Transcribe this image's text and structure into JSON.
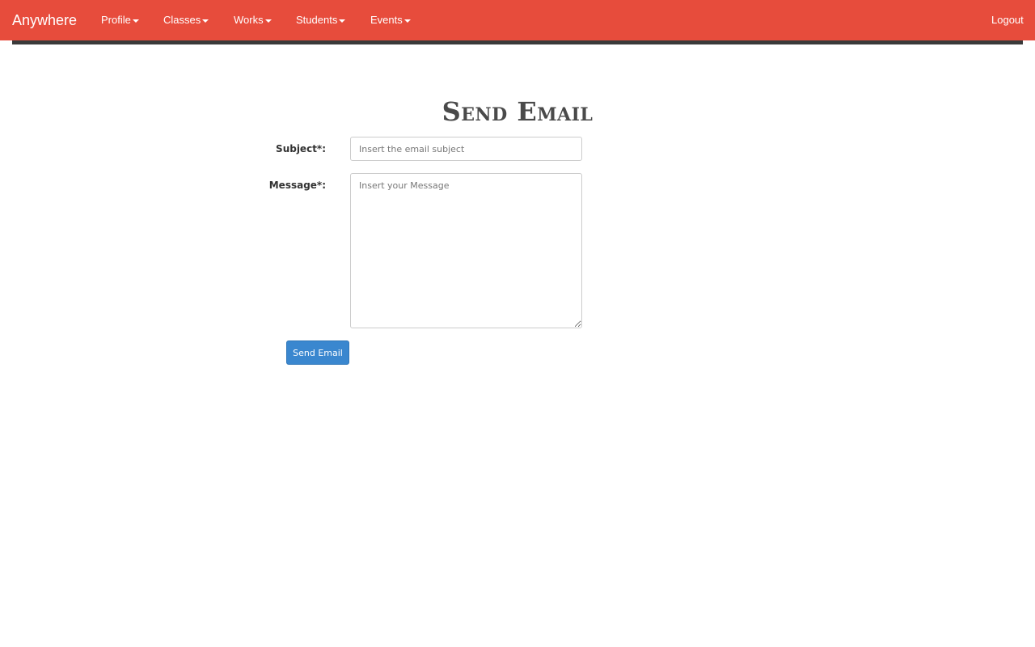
{
  "navbar": {
    "brand": "Anywhere",
    "items": [
      {
        "label": "Profile",
        "has_dropdown": true
      },
      {
        "label": "Classes",
        "has_dropdown": true
      },
      {
        "label": "Works",
        "has_dropdown": true
      },
      {
        "label": "Students",
        "has_dropdown": true
      },
      {
        "label": "Events",
        "has_dropdown": true
      }
    ],
    "logout_label": "Logout",
    "background_color": "#e74c3c",
    "underline_color": "#3a3a3a"
  },
  "form": {
    "title": "Send Email",
    "subject": {
      "label": "Subject*:",
      "value": "",
      "placeholder": "Insert the email subject"
    },
    "message": {
      "label": "Message*:",
      "value": "",
      "placeholder": "Insert your Message"
    },
    "submit_label": "Send Email",
    "submit_color": "#3a87cf"
  },
  "icons": {
    "dropdown": "caret-down-icon"
  }
}
